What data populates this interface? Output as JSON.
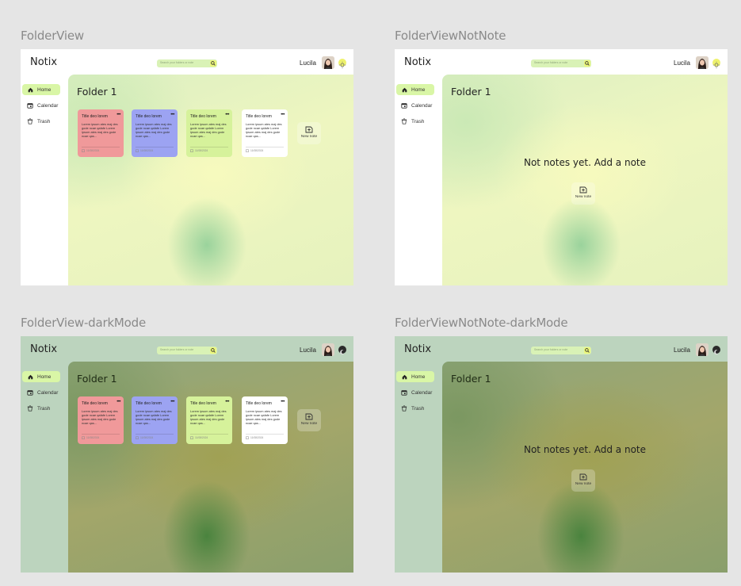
{
  "frames": [
    {
      "label": "FolderView",
      "mode": "light"
    },
    {
      "label": "FolderViewNotNote",
      "mode": "light"
    },
    {
      "label": "FolderView-darkMode",
      "mode": "dark"
    },
    {
      "label": "FolderViewNotNote-darkMode",
      "mode": "dark"
    }
  ],
  "app": {
    "logo": "Notix",
    "search_placeholder": "Search your folders or note",
    "user_name": "Lucila"
  },
  "sidebar": {
    "items": [
      {
        "label": "Home",
        "icon": "home-icon",
        "active": true
      },
      {
        "label": "Calendar",
        "icon": "calendar-icon",
        "active": false
      },
      {
        "label": "Trash",
        "icon": "trash-icon",
        "active": false
      }
    ]
  },
  "folder": {
    "title": "Folder 1",
    "notes": [
      {
        "title": "Title deo lorem",
        "menu": "•••",
        "body": "Lorem ipsum ates maj des gode ncae qafafe Lorem ipsum ates maj des gode ncae qas...",
        "date": "11/08/2024",
        "color": "#f0999a"
      },
      {
        "title": "Title deo lorem",
        "menu": "•••",
        "body": "Lorem ipsum ates maj des gode ncae qafafe Lorem ipsum ates maj des gode ncae qas...",
        "date": "11/08/2024",
        "color": "#9ca3f2"
      },
      {
        "title": "Title deo lorem",
        "menu": "•••",
        "body": "Lorem ipsum ates maj des gode ncae qafafe Lorem ipsum ates maj des gode ncae qas...",
        "date": "11/08/2024",
        "color": "#d6f29b"
      },
      {
        "title": "Title deo lorem",
        "menu": "•••",
        "body": "Lorem ipsum ates maj des gode ncae qafafe Lorem ipsum ates maj des gode ncae qas...",
        "date": "11/08/2024",
        "color": "#ffffff"
      }
    ],
    "new_note_label": "New note",
    "empty_message": "Not notes yet. Add a note"
  }
}
